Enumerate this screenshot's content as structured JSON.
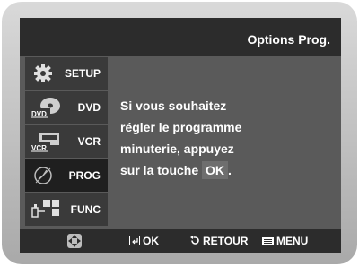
{
  "header": {
    "title": "Options Prog."
  },
  "sidebar": {
    "items": [
      {
        "label": "SETUP",
        "icon": "gear-icon",
        "active": false
      },
      {
        "label": "DVD",
        "icon": "dvd-disc-icon",
        "icon_text": "DVD",
        "active": false
      },
      {
        "label": "VCR",
        "icon": "vcr-tape-icon",
        "icon_text": "VCR",
        "active": false
      },
      {
        "label": "PROG",
        "icon": "clock-timer-icon",
        "active": true
      },
      {
        "label": "FUNC",
        "icon": "function-blocks-icon",
        "active": false
      }
    ]
  },
  "message": {
    "line1": "Si vous souhaitez",
    "line2": "régler le programme",
    "line3": "minuterie, appuyez",
    "line4_prefix": "sur la touche",
    "line4_key": "OK",
    "line4_suffix": "."
  },
  "footer": {
    "nav_icon": "direction-pad-icon",
    "ok_label": "OK",
    "return_label": "RETOUR",
    "menu_label": "MENU"
  },
  "colors": {
    "screen_bg": "#5a5a5a",
    "bar_bg": "#2c2c2c",
    "text": "#ffffff"
  }
}
